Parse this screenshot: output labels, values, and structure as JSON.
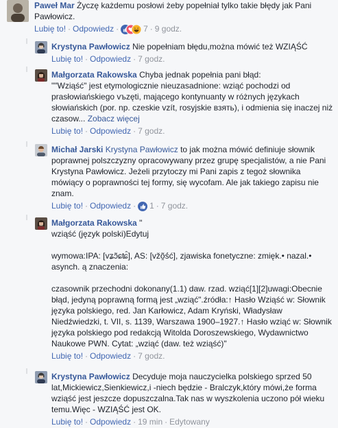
{
  "comments": [
    {
      "author": "Paweł Mar",
      "text": "Życzę każdemu posłowi żeby popełniał tylko takie błędy jak Pani Pawłowicz.",
      "actions": {
        "like": "Lubię to!",
        "reply": "Odpowiedz",
        "reactions_count": "7",
        "time": "9 godz."
      },
      "reactions": [
        "like-icon",
        "love-icon",
        "haha-icon"
      ]
    },
    {
      "author": "Krystyna Pawłowicz",
      "text": "Nie popełniam błędu,można mówić też WZIĄŚĆ",
      "actions": {
        "like": "Lubię to!",
        "reply": "Odpowiedz",
        "time": "7 godz."
      }
    },
    {
      "author": "Małgorzata Rakowska",
      "text": "Chyba jednak popełnia pani błąd:\n\"\"Wziąść\" jest etymologicznie nieuzasadnione: wziąć pochodzi od prasłowiańskiego vъzęti, mającego kontynuanty w różnych językach słowiańskich (por. np. czeskie vzít, rosyjskie взять), i odmienia się inaczej niż czasow...",
      "see_more": "Zobacz więcej",
      "actions": {
        "like": "Lubię to!",
        "reply": "Odpowiedz",
        "time": "7 godz."
      }
    },
    {
      "author": "Michał Jarski",
      "mention": "Krystyna Pawłowicz",
      "text": " to jak można mówić definiuje słownik poprawnej polszczyzny opracowywany przez grupę specjalistów, a nie Pani Krystyna Pawłowicz. Jeżeli przytoczy mi Pani zapis z tegoż słownika mówiący o poprawności tej formy, się wycofam. Ale jak takiego zapisu nie znam.",
      "actions": {
        "like": "Lubię to!",
        "reply": "Odpowiedz",
        "reactions_count": "1",
        "time": "7 godz."
      },
      "reactions": [
        "like-icon"
      ]
    },
    {
      "author": "Małgorzata Rakowska",
      "text": "\"\nwziąść (język polski)Edytuj\n\nwymowa:IPA: [vʑɔ̃ɕʨ̑], AS: [vžõ̯ś́ć], zjawiska fonetyczne: zmięk.• nazal.• asynch. ą znaczenia:\n\nczasownik przechodni dokonany(1.1) daw. rzad. wziąć[1][2]uwagi:Obecnie błąd, jedyną poprawną formą jest „wziąć\".źródła:↑ Hasło Wziąść w: Słownik języka polskiego, red. Jan Karłowicz, Adam Kryński, Władysław Niedźwiedzki, t. VII, s. 1139, Warszawa 1900–1927.↑ Hasło wziąć w: Słownik języka polskiego pod redakcją Witolda Doroszewskiego, Wydawnictwo Naukowe PWN. Cytat: „wziąć (daw. też wziąść)\"",
      "actions": {
        "like": "Lubię to!",
        "reply": "Odpowiedz",
        "time": "7 godz."
      }
    },
    {
      "author": "Krystyna Pawłowicz",
      "text": "Decyduje moja nauczycielka polskiego sprzed 50 lat,Mickiewicz,Sienkiewicz,i -niech będzie - Bralczyk,który mówi,że forma wziąść jest jeszcze dopuszczalna.Tak nas w wyszkolenia uczono pół wieku temu.Więc - WZIĄŚĆ jest OK.",
      "actions": {
        "like": "Lubię to!",
        "reply": "Odpowiedz",
        "time": "19 min",
        "edited": "Edytowany"
      }
    }
  ],
  "colors": {
    "link": "#365899",
    "action": "#4267b2",
    "meta": "#90949c",
    "like": "#4267b2",
    "love": "#f25268",
    "haha": "#f7b125"
  }
}
